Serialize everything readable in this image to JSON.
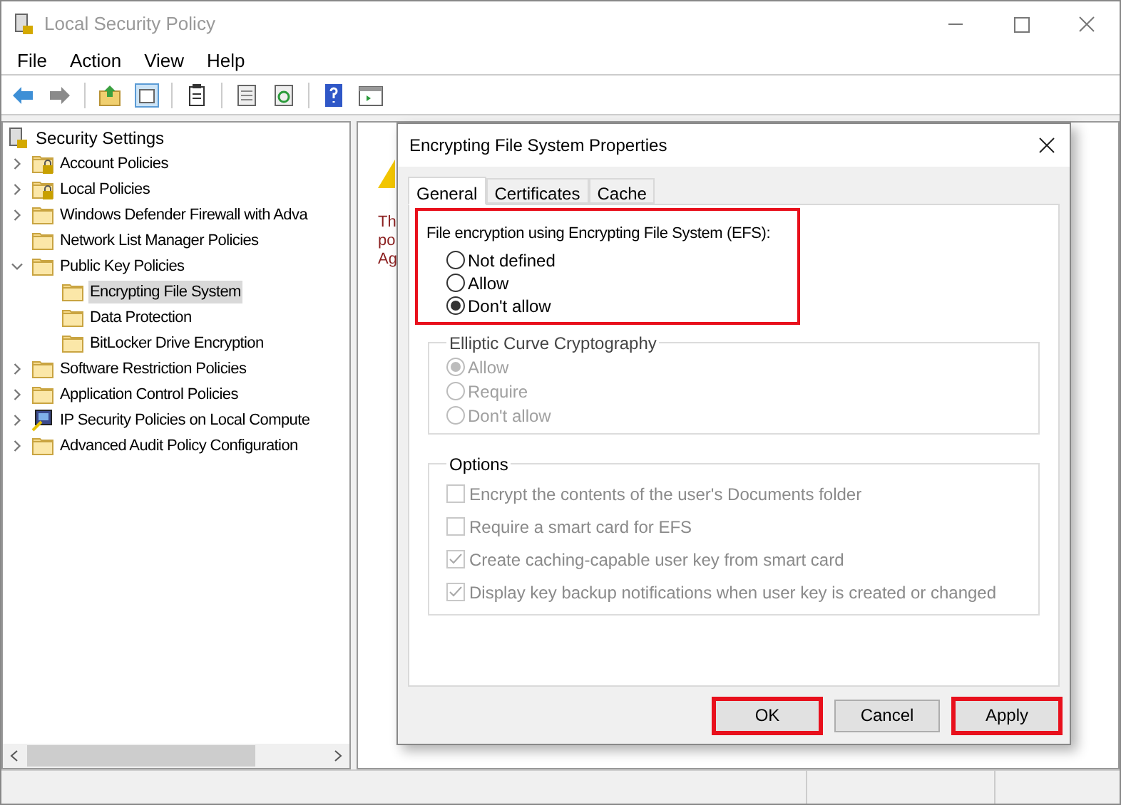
{
  "window": {
    "title": "Local Security Policy"
  },
  "menu": [
    "File",
    "Action",
    "View",
    "Help"
  ],
  "tree": {
    "root": "Security Settings",
    "items": [
      {
        "label": "Account Policies",
        "kind": "locked-folder",
        "expanded": false,
        "selected": false
      },
      {
        "label": "Local Policies",
        "kind": "locked-folder",
        "expanded": false,
        "selected": false
      },
      {
        "label": "Windows Defender Firewall with Adva",
        "kind": "folder",
        "expanded": false,
        "selected": false
      },
      {
        "label": "Network List Manager Policies",
        "kind": "folder",
        "selected": false
      },
      {
        "label": "Public Key Policies",
        "kind": "folder",
        "expanded": true,
        "selected": false,
        "children": [
          {
            "label": "Encrypting File System",
            "kind": "folder",
            "selected": true
          },
          {
            "label": "Data Protection",
            "kind": "folder",
            "selected": false
          },
          {
            "label": "BitLocker Drive Encryption",
            "kind": "folder",
            "selected": false
          }
        ]
      },
      {
        "label": "Software Restriction Policies",
        "kind": "folder",
        "expanded": false,
        "selected": false
      },
      {
        "label": "Application Control Policies",
        "kind": "folder",
        "expanded": false,
        "selected": false
      },
      {
        "label": "IP Security Policies on Local Compute",
        "kind": "computer",
        "expanded": false,
        "selected": false
      },
      {
        "label": "Advanced Audit Policy Configuration",
        "kind": "folder",
        "expanded": false,
        "selected": false
      }
    ]
  },
  "right_pane": {
    "text_fragments": [
      "Th",
      "po",
      "Ag"
    ]
  },
  "dialog": {
    "title": "Encrypting File System Properties",
    "tabs": [
      {
        "label": "General",
        "selected": true
      },
      {
        "label": "Certificates",
        "selected": false
      },
      {
        "label": "Cache",
        "selected": false
      }
    ],
    "efs": {
      "label": "File encryption using Encrypting File System (EFS):",
      "highlighted": true,
      "options": [
        {
          "label": "Not defined",
          "selected": false
        },
        {
          "label": "Allow",
          "selected": false
        },
        {
          "label": "Don't allow",
          "selected": true
        }
      ]
    },
    "ecc": {
      "title": "Elliptic Curve Cryptography",
      "disabled": true,
      "options": [
        {
          "label": "Allow",
          "selected": true
        },
        {
          "label": "Require",
          "selected": false
        },
        {
          "label": "Don't allow",
          "selected": false
        }
      ]
    },
    "options": {
      "title": "Options",
      "disabled": true,
      "items": [
        {
          "label": "Encrypt the contents of the user's Documents folder",
          "checked": false
        },
        {
          "label": "Require a smart card for EFS",
          "checked": false
        },
        {
          "label": "Create caching-capable user key from smart card",
          "checked": true
        },
        {
          "label": "Display key backup notifications when user key is created or changed",
          "checked": true
        }
      ]
    },
    "buttons": [
      {
        "label": "OK",
        "highlighted": true
      },
      {
        "label": "Cancel",
        "highlighted": false
      },
      {
        "label": "Apply",
        "highlighted": true
      }
    ]
  }
}
